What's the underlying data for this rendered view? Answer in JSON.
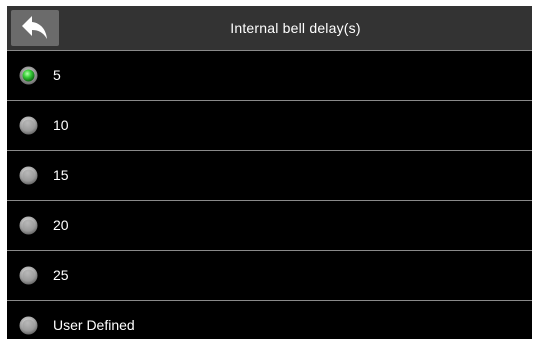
{
  "header": {
    "title": "Internal bell delay(s)",
    "back_icon": "back-arrow-icon"
  },
  "options": [
    {
      "label": "5",
      "selected": true
    },
    {
      "label": "10",
      "selected": false
    },
    {
      "label": "15",
      "selected": false
    },
    {
      "label": "20",
      "selected": false
    },
    {
      "label": "25",
      "selected": false
    },
    {
      "label": "User Defined",
      "selected": false
    }
  ],
  "colors": {
    "screen_bg": "#000000",
    "titlebar_bg": "#333333",
    "divider": "#8a8a8a",
    "radio_selected": "#3cd23c",
    "radio_unselected": "#a0a0a0"
  }
}
